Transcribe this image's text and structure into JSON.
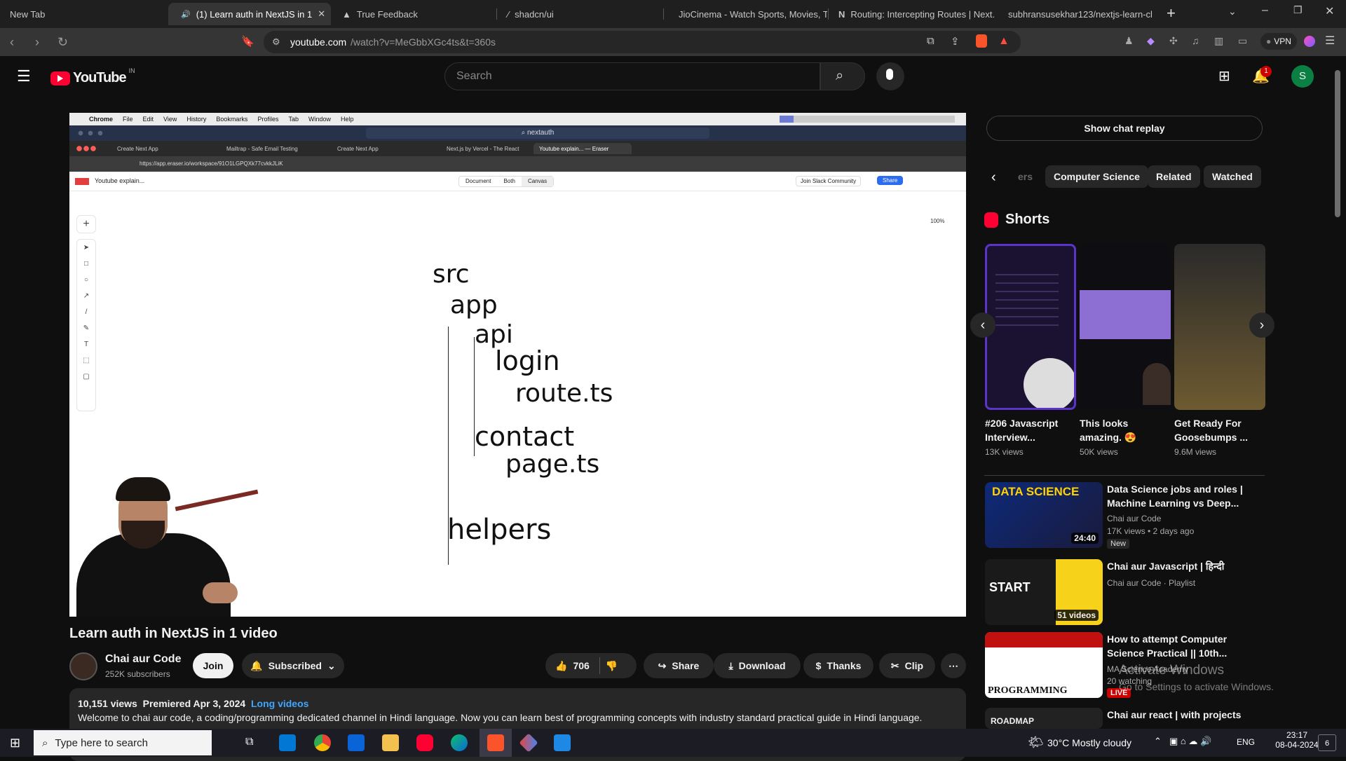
{
  "browser": {
    "new_tab_label": "New Tab",
    "tabs": [
      {
        "label": "(1) Learn auth in NextJS in 1",
        "active": true
      },
      {
        "label": "True Feedback"
      },
      {
        "label": "shadcn/ui"
      },
      {
        "label": "JioCinema - Watch Sports, Movies, T"
      },
      {
        "label": "Routing: Intercepting Routes | Next."
      },
      {
        "label": "subhransusekhar123/nextjs-learn-cl"
      }
    ],
    "url_host": "youtube.com",
    "url_path": "/watch?v=MeGbbXGc4ts&t=360s",
    "vpn_label": "VPN"
  },
  "yt": {
    "logo_text": "YouTube",
    "country": "IN",
    "search_placeholder": "Search",
    "notif_count": "1",
    "avatar_letter": "S"
  },
  "video_frame": {
    "mac_menu": [
      "Chrome",
      "File",
      "Edit",
      "View",
      "History",
      "Bookmarks",
      "Profiles",
      "Tab",
      "Window",
      "Help"
    ],
    "finder_search": "nextauth",
    "inner_tabs": [
      "Create Next App",
      "Mailtrap - Safe Email Testing",
      "Create Next App",
      "Next.js by Vercel - The React",
      "Youtube explain... — Eraser"
    ],
    "inner_url": "https://app.eraser.io/workspace/91O1LGPQXk77cvkkJLiK",
    "file_name": "Youtube explain...",
    "modes": [
      "Document",
      "Both",
      "Canvas"
    ],
    "slack_label": "Join Slack Community",
    "share_label": "Share",
    "zoom": "100%",
    "tree": {
      "src": "src",
      "app": "app",
      "api": "api",
      "login": "login",
      "route": "route.ts",
      "contact": "contact",
      "page": "page.ts",
      "helpers": "helpers"
    }
  },
  "video": {
    "title": "Learn auth in NextJS in 1 video",
    "channel": "Chai aur Code",
    "subscribers": "252K subscribers",
    "join_label": "Join",
    "subscribed_label": "Subscribed",
    "likes": "706",
    "share_label": "Share",
    "download_label": "Download",
    "thanks_label": "Thanks",
    "clip_label": "Clip",
    "views": "10,151 views",
    "premiered": "Premiered Apr 3, 2024",
    "tag": "Long videos",
    "description": "Welcome to chai aur code, a coding/programming dedicated channel in Hindi language. Now you can learn best of programming concepts with industry standard practical guide in Hindi language."
  },
  "sidebar": {
    "chat_replay": "Show chat replay",
    "chips": [
      "ers",
      "Computer Science",
      "Related",
      "Watched"
    ],
    "shorts_title": "Shorts",
    "shorts": [
      {
        "title": "#206 Javascript Interview...",
        "views": "13K views"
      },
      {
        "title": "This looks amazing. 😍",
        "views": "50K views"
      },
      {
        "title": "Get Ready For Goosebumps ...",
        "views": "9.6M views"
      }
    ],
    "videos": [
      {
        "title": "Data Science jobs and roles | Machine Learning vs Deep...",
        "channel": "Chai aur Code",
        "meta": "17K views • 2 days ago",
        "badge": "New",
        "duration": "24:40",
        "thumb_text": "DATA SCIENCE"
      },
      {
        "title": "Chai aur Javascript | हिन्दी",
        "channel": "Chai aur Code · Playlist",
        "duration": "51 videos",
        "thumb_text": "START"
      },
      {
        "title": "How to attempt Computer Science Practical || 10th...",
        "channel": "MA Science Academy",
        "meta": "20 watching",
        "badge": "LIVE",
        "thumb_text": "PROGRAMMING"
      },
      {
        "title": "Chai aur react | with projects",
        "thumb_text": "ROADMAP"
      }
    ]
  },
  "watermark": {
    "line1": "Activate Windows",
    "line2": "Go to Settings to activate Windows."
  },
  "taskbar": {
    "search_placeholder": "Type here to search",
    "weather": "30°C  Mostly cloudy",
    "lang": "ENG",
    "time": "23:17",
    "date": "08-04-2024",
    "notif": "6"
  }
}
